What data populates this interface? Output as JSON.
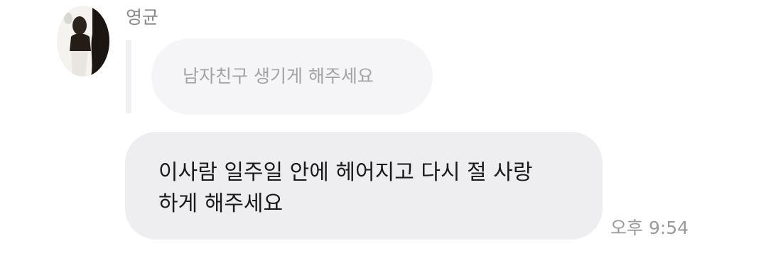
{
  "sender": {
    "name": "영균",
    "avatar_icon": "profile-photo"
  },
  "reply": {
    "quoted_text": "남자친구 생기게 해주세요"
  },
  "message": {
    "lines": [
      "이사람 일주일 안에 헤어지고 다시 절 사랑",
      "하게 해주세요"
    ],
    "time": "오후 9:54"
  },
  "colors": {
    "background": "#ffffff",
    "bubble": "#eeeef1",
    "reply_bubble": "#f5f5f8",
    "muted_text": "#9a9a9d",
    "body_text": "#1a1a1a"
  }
}
